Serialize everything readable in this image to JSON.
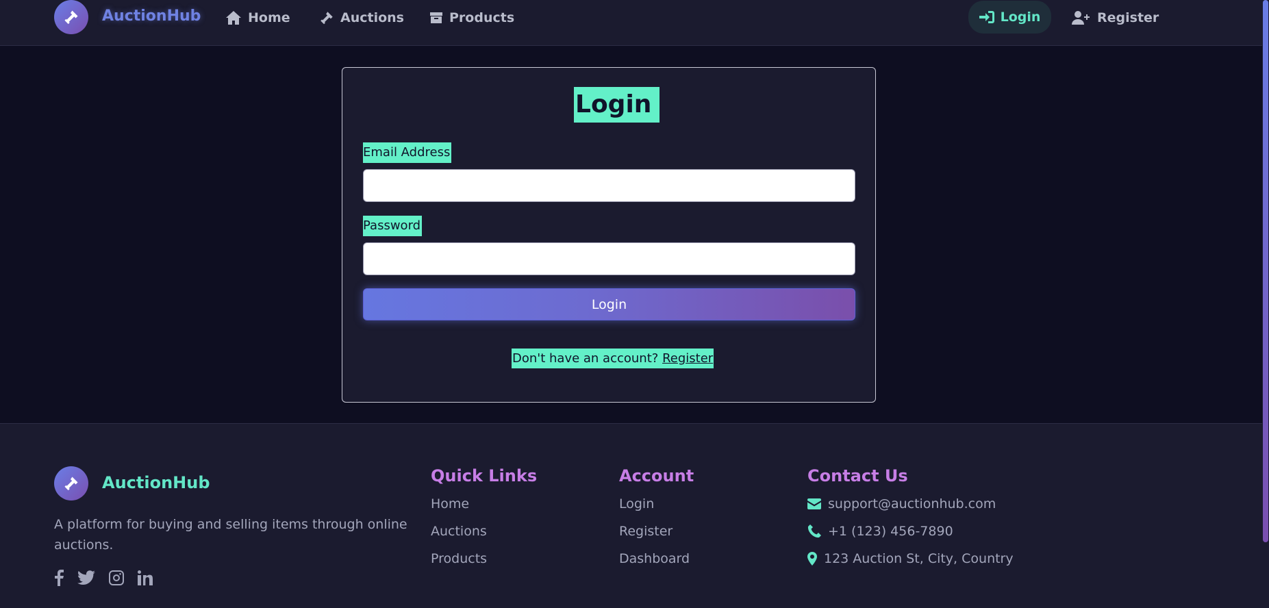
{
  "nav": {
    "brand": "AuctionHub",
    "items": [
      {
        "label": "Home",
        "icon": "home-icon"
      },
      {
        "label": "Auctions",
        "icon": "gavel-icon"
      },
      {
        "label": "Products",
        "icon": "box-icon"
      }
    ],
    "login": "Login",
    "register": "Register"
  },
  "login_form": {
    "title": "Login",
    "email_label": "Email Address",
    "email_value": "",
    "password_label": "Password",
    "password_value": "",
    "submit_label": "Login",
    "signup_prompt": "Don't have an account?",
    "signup_link": "Register"
  },
  "footer": {
    "brand": "AuctionHub",
    "description": "A platform for buying and selling items through online auctions.",
    "social": [
      "facebook-icon",
      "twitter-icon",
      "instagram-icon",
      "linkedin-icon"
    ],
    "quick_links": {
      "title": "Quick Links",
      "items": [
        "Home",
        "Auctions",
        "Products"
      ]
    },
    "account": {
      "title": "Account",
      "items": [
        "Login",
        "Register",
        "Dashboard"
      ]
    },
    "contact": {
      "title": "Contact Us",
      "email": "support@auctionhub.com",
      "phone": "+1 (123) 456-7890",
      "address": "123 Auction St, City, Country"
    }
  },
  "colors": {
    "accent_teal": "#63e6c7",
    "accent_purple": "#c77ee6",
    "primary_blue": "#6677e0",
    "background": "#0e0e21",
    "surface": "#1b1b2f"
  }
}
